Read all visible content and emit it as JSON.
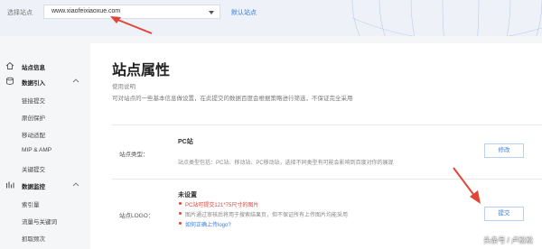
{
  "topbar": {
    "site_label": "选择站点",
    "site_value": "www.xiaofeixiaoxue.com",
    "default_site": "默认站点"
  },
  "sidebar": {
    "items": [
      {
        "label": "站点信息",
        "icon": "home-icon",
        "group": true
      },
      {
        "label": "数据引入",
        "icon": "data-import-icon",
        "group": true,
        "expanded": true
      },
      {
        "label": "链接提交"
      },
      {
        "label": "原创保护"
      },
      {
        "label": "移动适配"
      },
      {
        "label": "MIP & AMP"
      },
      {
        "label": "关键提交"
      },
      {
        "label": "数据监控",
        "icon": "chart-icon",
        "group": true,
        "expanded": true
      },
      {
        "label": "索引量"
      },
      {
        "label": "流量与关键词"
      },
      {
        "label": "抓取频次"
      }
    ]
  },
  "main": {
    "title": "站点属性",
    "usage_title": "使用说明",
    "usage_desc": "可对站点的一些基本信息做设置，在此提交的数据百度会根据策略进行筛选，不保证完全采用",
    "site_type": {
      "label": "站点类型：",
      "value": "PC站",
      "desc": "站点类型包括：PC站、移动站、PC移动站，选择不同类型有可能会影响到百度对你的展现",
      "button": "修改"
    },
    "site_logo": {
      "label": "站点LOGO：",
      "status": "未设置",
      "rules": [
        {
          "text": "PC站可提交121*75尺寸的图片",
          "highlight": true
        },
        {
          "text": "图片通过审核后将用于搜索结果页，但不保证所有上传图片均能采用",
          "highlight": false
        },
        {
          "text": "如何正确上传logo?",
          "link": true
        }
      ],
      "button": "提交"
    }
  },
  "watermark": "头条号 / 卢松松",
  "colors": {
    "accent": "#3b7bd8",
    "arrow": "#e0453a",
    "topbar_bg": "#eef2f8"
  }
}
